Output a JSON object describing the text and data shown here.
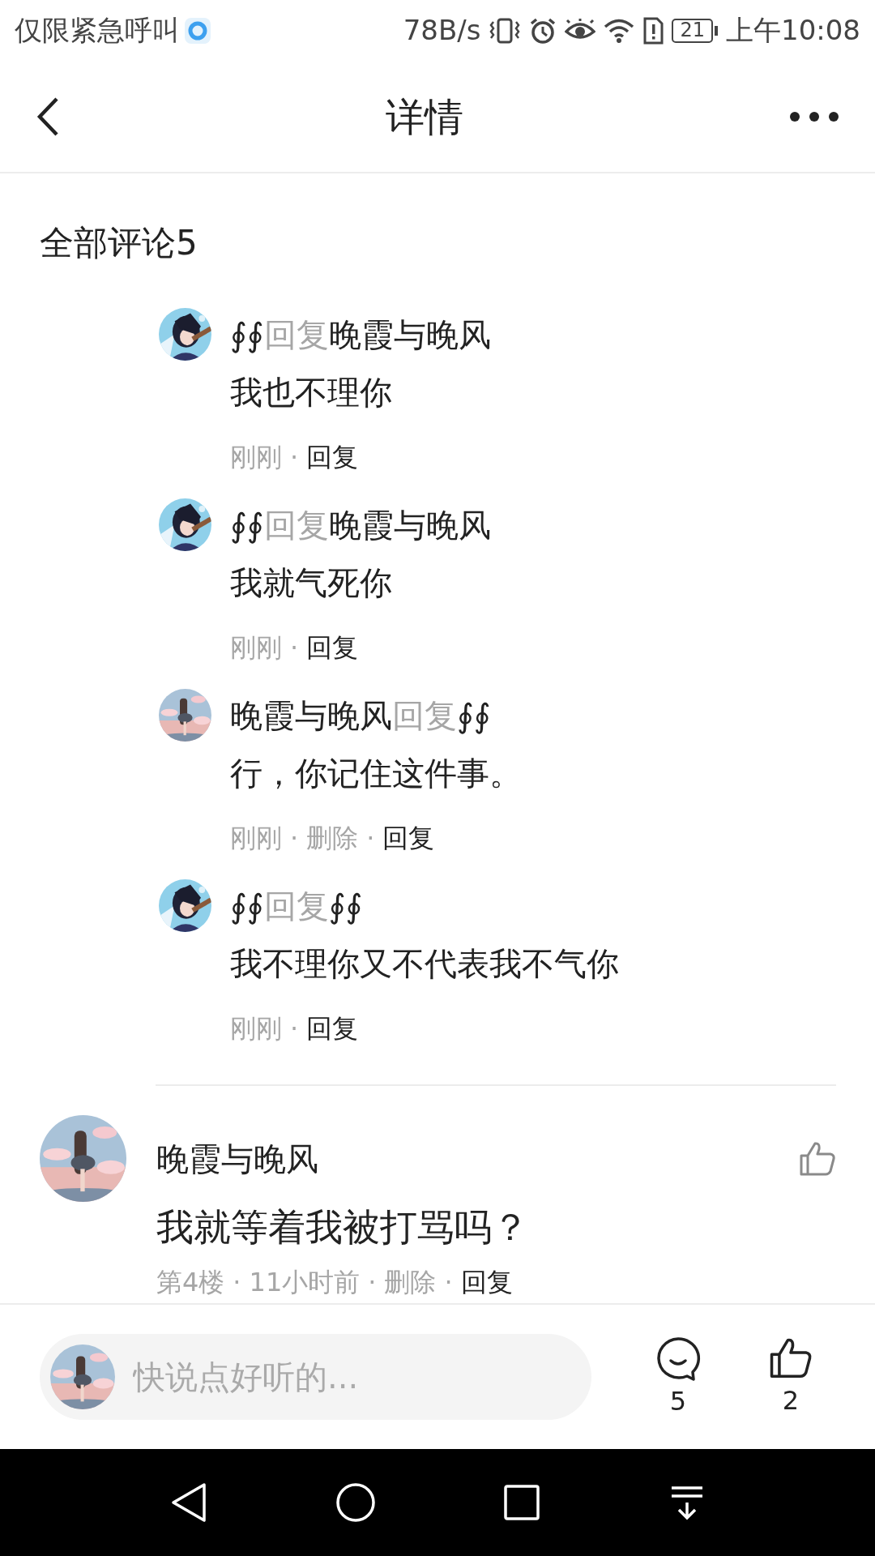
{
  "status_bar": {
    "left_text": "仅限紧急呼叫",
    "speed": "78B/s",
    "battery": "21",
    "time": "上午10:08"
  },
  "header": {
    "title": "详情"
  },
  "comments_title": "全部评论5",
  "replies": [
    {
      "from": "∮∮",
      "reply_word": "回复",
      "to": "晚霞与晚风",
      "text": "我也不理你",
      "meta": [
        {
          "text": "刚刚",
          "kind": "info"
        },
        {
          "text": "·",
          "kind": "dot"
        },
        {
          "text": "回复",
          "kind": "action"
        }
      ]
    },
    {
      "from": "∮∮",
      "reply_word": "回复",
      "to": "晚霞与晚风",
      "text": "我就气死你",
      "meta": [
        {
          "text": "刚刚",
          "kind": "info"
        },
        {
          "text": "·",
          "kind": "dot"
        },
        {
          "text": "回复",
          "kind": "action"
        }
      ]
    },
    {
      "from": "晚霞与晚风",
      "reply_word": "回复",
      "to": "∮∮",
      "text": "行，你记住这件事。",
      "meta": [
        {
          "text": "刚刚",
          "kind": "info"
        },
        {
          "text": "·",
          "kind": "dot"
        },
        {
          "text": "删除",
          "kind": "info"
        },
        {
          "text": "·",
          "kind": "dot"
        },
        {
          "text": "回复",
          "kind": "action"
        }
      ]
    },
    {
      "from": "∮∮",
      "reply_word": "回复",
      "to": "∮∮",
      "text": "我不理你又不代表我不气你",
      "meta": [
        {
          "text": "刚刚",
          "kind": "info"
        },
        {
          "text": "·",
          "kind": "dot"
        },
        {
          "text": "回复",
          "kind": "action"
        }
      ]
    }
  ],
  "comment": {
    "author": "晚霞与晚风",
    "text": "我就等着我被打骂吗？",
    "meta": [
      {
        "text": "第4楼",
        "kind": "info"
      },
      {
        "text": "·",
        "kind": "dot"
      },
      {
        "text": "11小时前",
        "kind": "info"
      },
      {
        "text": "·",
        "kind": "dot"
      },
      {
        "text": "删除",
        "kind": "info"
      },
      {
        "text": "·",
        "kind": "dot"
      },
      {
        "text": "回复",
        "kind": "action"
      }
    ]
  },
  "bottom_bar": {
    "placeholder": "快说点好听的...",
    "comment_count": "5",
    "like_count": "2"
  }
}
